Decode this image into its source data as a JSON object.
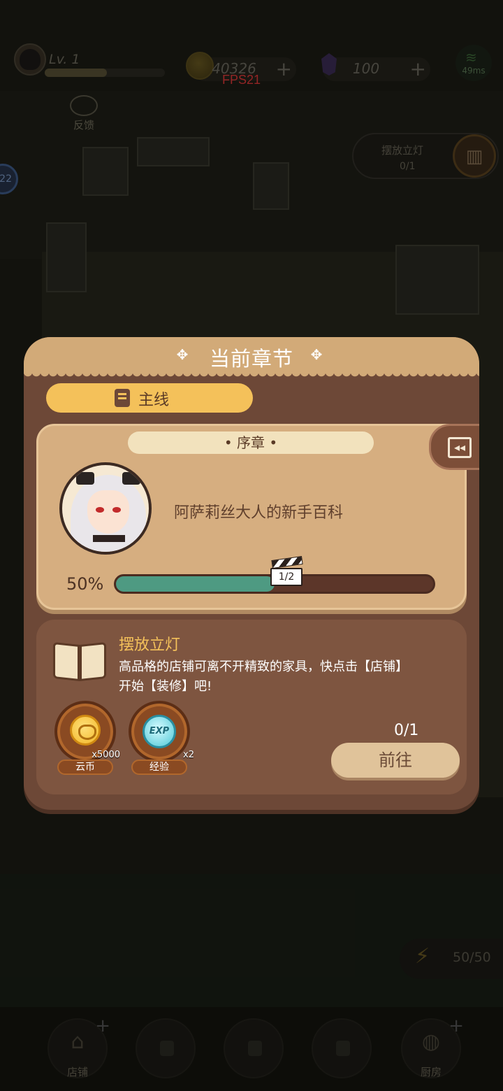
{
  "hud": {
    "level": "Lv. 1",
    "level_progress": 0.52,
    "coins": "40326",
    "gems": "100",
    "ping": "49ms",
    "fps": "FPS21"
  },
  "side": {
    "feedback_label": "反馈",
    "badge_count": "22"
  },
  "quest_chip": {
    "title": "摆放立灯",
    "count": "0/1"
  },
  "dialog": {
    "title": "当前章节",
    "tab_label": "主线",
    "chapter": {
      "label": "• 序章 •",
      "name": "阿萨莉丝大人的新手百科",
      "percent_text": "50%",
      "progress": 0.5,
      "step": "1/2"
    },
    "task": {
      "title": "摆放立灯",
      "description": "高品格的店铺可离不开精致的家具，快点击【店铺】开始【装修】吧!",
      "count": "0/1",
      "go_label": "前往",
      "rewards": [
        {
          "icon": "cloud-coin-icon",
          "qty": "x5000",
          "name": "云币"
        },
        {
          "icon": "exp-icon",
          "icon_text": "EXP",
          "qty": "x2",
          "name": "经验"
        }
      ]
    }
  },
  "bottom_nav": {
    "shop_label": "店铺",
    "kitchen_label": "厨房",
    "energy": "50/50"
  },
  "colors": {
    "accent_gold": "#f4c15a",
    "dialog_brown": "#6d4837",
    "progress_green": "#4e9a82",
    "fps_red": "#e23a3a"
  }
}
